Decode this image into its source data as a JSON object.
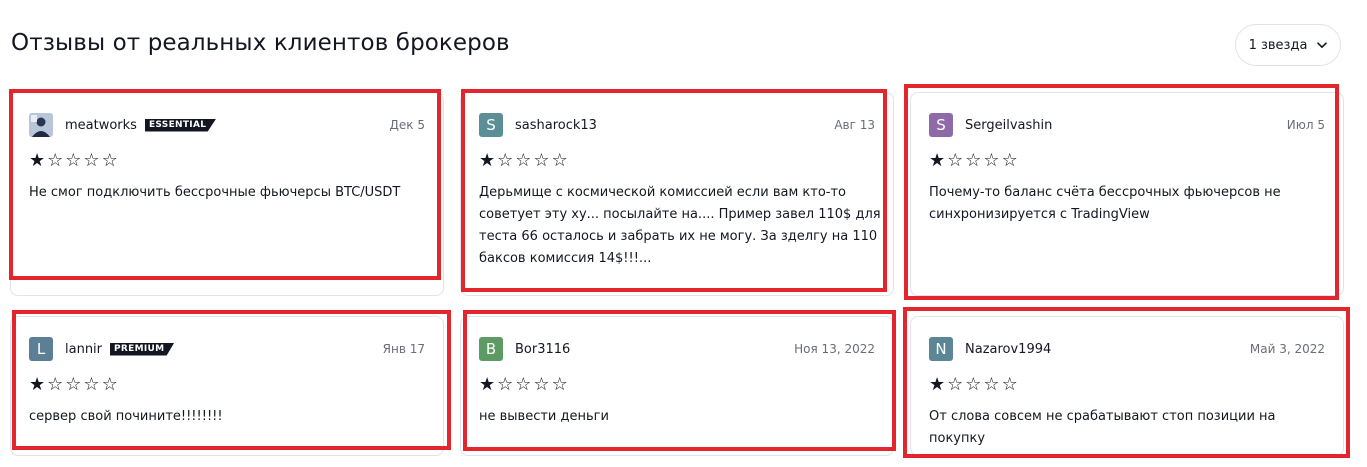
{
  "page": {
    "title": "Отзывы от реальных клиентов брокеров",
    "filter_label": "1 звезда"
  },
  "colors": {
    "highlight": "#e3262e",
    "badge_bg": "#131722",
    "star": "#131722"
  },
  "reviews": [
    {
      "user": "meatworks",
      "avatar_letter": "",
      "avatar_kind": "photo",
      "avatar_color": "#c8d0dc",
      "badge": "ESSENTIAL",
      "date": "Дек 5",
      "rating": 1,
      "max_rating": 5,
      "text": "Не смог подключить бессрочные фьючерсы BTC/USDT"
    },
    {
      "user": "sasharock13",
      "avatar_letter": "S",
      "avatar_kind": "letter",
      "avatar_color": "#5b8e96",
      "badge": "",
      "date": "Авг 13",
      "rating": 1,
      "max_rating": 5,
      "text": "Дерьмище с космической комиссией если вам кто-то советует эту ху... посылайте на.... Пример завел 110$ для теста 66 осталось и забрать их не могу. За зделгу на 110 баксов комиссия 14$!!!..."
    },
    {
      "user": "Sergeilvashin",
      "avatar_letter": "S",
      "avatar_kind": "letter",
      "avatar_color": "#8e6aa8",
      "badge": "",
      "date": "Июл 5",
      "rating": 1,
      "max_rating": 5,
      "text": "Почему-то баланс счёта бессрочных фьючерсов не синхронизируется с TradingView"
    },
    {
      "user": "lannir",
      "avatar_letter": "L",
      "avatar_kind": "letter",
      "avatar_color": "#5d7f96",
      "badge": "PREMIUM",
      "date": "Янв 17",
      "rating": 1,
      "max_rating": 5,
      "text": "сервер свой почините!!!!!!!!"
    },
    {
      "user": "Bor3116",
      "avatar_letter": "B",
      "avatar_kind": "letter",
      "avatar_color": "#5e9a64",
      "badge": "",
      "date": "Ноя 13, 2022",
      "rating": 1,
      "max_rating": 5,
      "text": "не вывести деньги"
    },
    {
      "user": "Nazarov1994",
      "avatar_letter": "N",
      "avatar_kind": "letter",
      "avatar_color": "#5b8696",
      "badge": "",
      "date": "Май 3, 2022",
      "rating": 1,
      "max_rating": 5,
      "text": "От слова совсем не срабатывают стоп позиции на покупку"
    }
  ]
}
